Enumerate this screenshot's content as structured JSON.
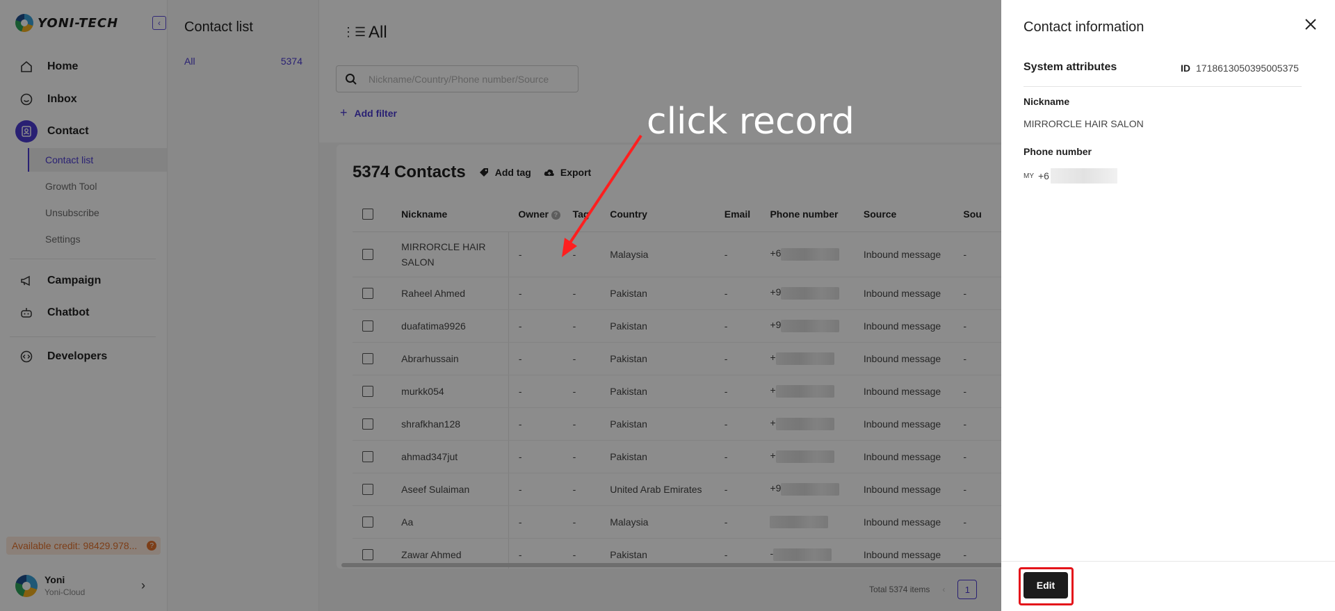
{
  "brand": {
    "name": "YONI-TECH"
  },
  "nav": {
    "items": [
      {
        "label": "Home",
        "icon": "home-icon"
      },
      {
        "label": "Inbox",
        "icon": "inbox-icon"
      },
      {
        "label": "Contact",
        "icon": "contact-icon",
        "active": true
      },
      {
        "label": "Campaign",
        "icon": "megaphone-icon"
      },
      {
        "label": "Chatbot",
        "icon": "robot-icon"
      },
      {
        "label": "Developers",
        "icon": "code-icon"
      }
    ],
    "sub_items": [
      {
        "label": "Contact list",
        "active": true
      },
      {
        "label": "Growth Tool"
      },
      {
        "label": "Unsubscribe"
      },
      {
        "label": "Settings"
      }
    ],
    "credit": "Available credit: 98429.978...",
    "user": {
      "name": "Yoni",
      "org": "Yoni-Cloud"
    }
  },
  "contact_list": {
    "title": "Contact list",
    "segment": {
      "label": "All",
      "count": "5374"
    }
  },
  "main": {
    "title": "All",
    "search_placeholder": "Nickname/Country/Phone number/Source",
    "add_filter": "Add filter",
    "count_label": "5374 Contacts",
    "add_tag": "Add tag",
    "export": "Export",
    "columns": [
      "Nickname",
      "Owner",
      "Tag",
      "Country",
      "Email",
      "Phone number",
      "Source",
      "Sou"
    ],
    "rows": [
      {
        "nickname": "MIRRORCLE HAIR SALON",
        "owner": "-",
        "tag": "-",
        "country": "Malaysia",
        "email": "-",
        "phone": "+6",
        "source": "Inbound message",
        "sou": "-"
      },
      {
        "nickname": "Raheel Ahmed",
        "owner": "-",
        "tag": "-",
        "country": "Pakistan",
        "email": "-",
        "phone": "+9",
        "source": "Inbound message",
        "sou": "-"
      },
      {
        "nickname": "duafatima9926",
        "owner": "-",
        "tag": "-",
        "country": "Pakistan",
        "email": "-",
        "phone": "+9",
        "source": "Inbound message",
        "sou": "-"
      },
      {
        "nickname": "Abrarhussain",
        "owner": "-",
        "tag": "-",
        "country": "Pakistan",
        "email": "-",
        "phone": "+",
        "source": "Inbound message",
        "sou": "-"
      },
      {
        "nickname": "murkk054",
        "owner": "-",
        "tag": "-",
        "country": "Pakistan",
        "email": "-",
        "phone": "+",
        "source": "Inbound message",
        "sou": "-"
      },
      {
        "nickname": "shrafkhan128",
        "owner": "-",
        "tag": "-",
        "country": "Pakistan",
        "email": "-",
        "phone": "+",
        "source": "Inbound message",
        "sou": "-"
      },
      {
        "nickname": "ahmad347jut",
        "owner": "-",
        "tag": "-",
        "country": "Pakistan",
        "email": "-",
        "phone": "+",
        "source": "Inbound message",
        "sou": "-"
      },
      {
        "nickname": "Aseef Sulaiman",
        "owner": "-",
        "tag": "-",
        "country": "United Arab Emirates",
        "email": "-",
        "phone": "+9",
        "source": "Inbound message",
        "sou": "-"
      },
      {
        "nickname": "Aa",
        "owner": "-",
        "tag": "-",
        "country": "Malaysia",
        "email": "-",
        "phone": "",
        "source": "Inbound message",
        "sou": "-"
      },
      {
        "nickname": "Zawar Ahmed",
        "owner": "-",
        "tag": "-",
        "country": "Pakistan",
        "email": "-",
        "phone": "-",
        "source": "Inbound message",
        "sou": "-"
      }
    ],
    "pager": {
      "total": "Total 5374 items",
      "page": "1"
    }
  },
  "annotation": {
    "text": "click record"
  },
  "drawer": {
    "title": "Contact information",
    "system_attributes": "System attributes",
    "id_label": "ID",
    "id_value": "1718613050395005375",
    "nickname_label": "Nickname",
    "nickname_value": "MIRRORCLE HAIR SALON",
    "phone_label": "Phone number",
    "phone_country": "MY",
    "phone_prefix": "+6",
    "edit_label": "Edit"
  }
}
